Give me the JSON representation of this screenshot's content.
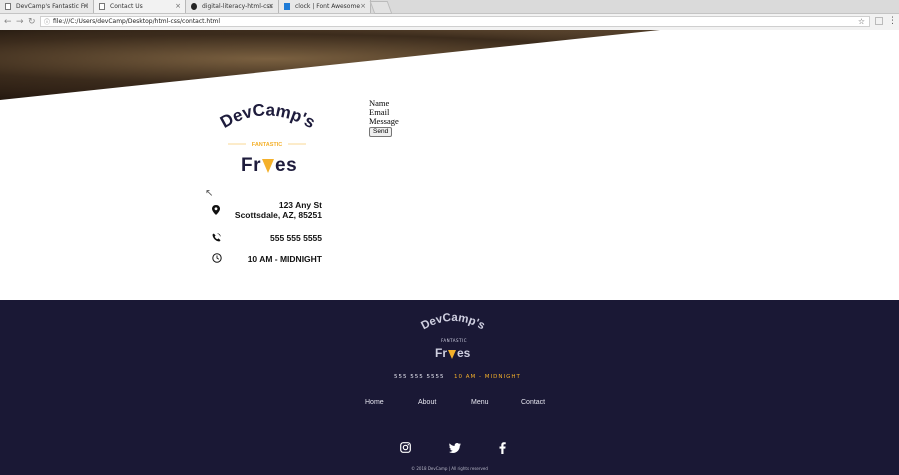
{
  "browser": {
    "tabs": [
      {
        "label": "DevCamp's Fantastic Fri"
      },
      {
        "label": "Contact Us"
      },
      {
        "label": "digital-literacy-html-css"
      },
      {
        "label": "clock | Font Awesome"
      }
    ],
    "url": "file:///C:/Users/devCamp/Desktop/html-css/contact.html"
  },
  "brand": {
    "name": "DevCamp's",
    "tagline": "FANTASTIC",
    "product": "Fries"
  },
  "contact": {
    "address_line1": "123 Any St",
    "address_line2": "Scottsdale, AZ, 85251",
    "phone": "555 555 5555",
    "hours": "10 AM - MIDNIGHT"
  },
  "form": {
    "name_label": "Name",
    "email_label": "Email",
    "message_label": "Message",
    "send_label": "Send"
  },
  "footer": {
    "phone": "555 555 5555",
    "hours": "10 AM - MIDNIGHT",
    "nav": [
      "Home",
      "About",
      "Menu",
      "Contact"
    ],
    "copyright": "© 2018 DevCamp | All rights reserved"
  },
  "icons": {
    "address": "map-marker-icon",
    "phone": "phone-icon",
    "hours": "clock-icon",
    "social": [
      "instagram-icon",
      "twitter-icon",
      "facebook-icon"
    ]
  },
  "colors": {
    "navy": "#1e1c3c",
    "footer_bg": "#1a1835",
    "accent": "#f4b02a"
  }
}
